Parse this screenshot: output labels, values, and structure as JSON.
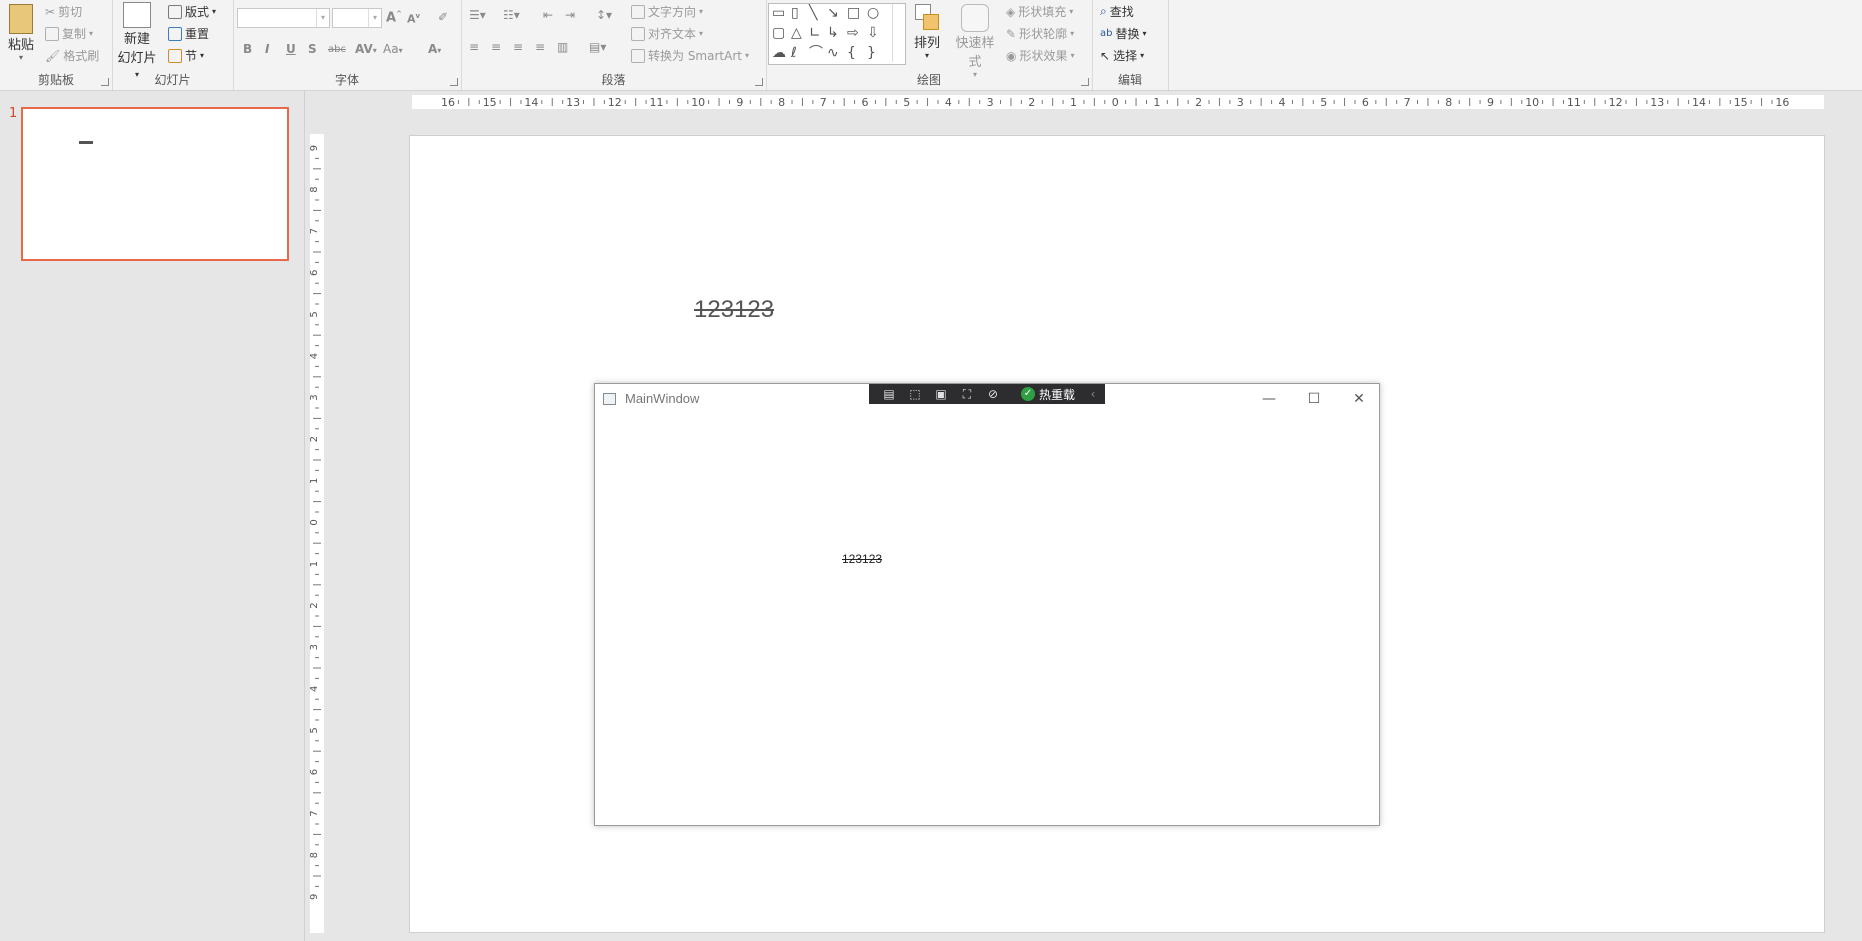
{
  "ribbon": {
    "clipboard": {
      "paste": "粘贴",
      "cut": "剪切",
      "copy": "复制",
      "format_painter": "格式刷",
      "label": "剪贴板"
    },
    "slides": {
      "new_slide": "新建",
      "new_slide_2": "幻灯片",
      "layout": "版式",
      "reset": "重置",
      "section": "节",
      "label": "幻灯片"
    },
    "font": {
      "label": "字体",
      "bold": "B",
      "italic": "I",
      "underline": "U",
      "shadow": "S",
      "strike": "abc",
      "spacing": "AV",
      "case": "Aa",
      "color": "A",
      "grow": "A",
      "shrink": "A"
    },
    "paragraph": {
      "text_direction": "文字方向",
      "align_text": "对齐文本",
      "smartart": "转换为 SmartArt",
      "label": "段落"
    },
    "drawing": {
      "arrange": "排列",
      "quick_styles": "快速样式",
      "shape_fill": "形状填充",
      "shape_outline": "形状轮廓",
      "shape_effects": "形状效果",
      "label": "绘图"
    },
    "editing": {
      "find": "查找",
      "replace": "替换",
      "select": "选择",
      "label": "编辑"
    }
  },
  "thumbnail": {
    "number": "1"
  },
  "ruler": {
    "h_labels": [
      "16",
      "15",
      "14",
      "13",
      "12",
      "11",
      "10",
      "9",
      "8",
      "7",
      "6",
      "5",
      "4",
      "3",
      "2",
      "1",
      "0",
      "1",
      "2",
      "3",
      "4",
      "5",
      "6",
      "7",
      "8",
      "9",
      "10",
      "11",
      "12",
      "13",
      "14",
      "15",
      "16"
    ],
    "v_labels": [
      "9",
      "8",
      "7",
      "6",
      "5",
      "4",
      "3",
      "2",
      "1",
      "0",
      "1",
      "2",
      "3",
      "4",
      "5",
      "6",
      "7",
      "8",
      "9"
    ]
  },
  "slide": {
    "text": "123123"
  },
  "window": {
    "title": "MainWindow",
    "hot_reload": "热重载",
    "content_text": "123123",
    "minimize": "—",
    "maximize": "☐",
    "close": "✕"
  }
}
